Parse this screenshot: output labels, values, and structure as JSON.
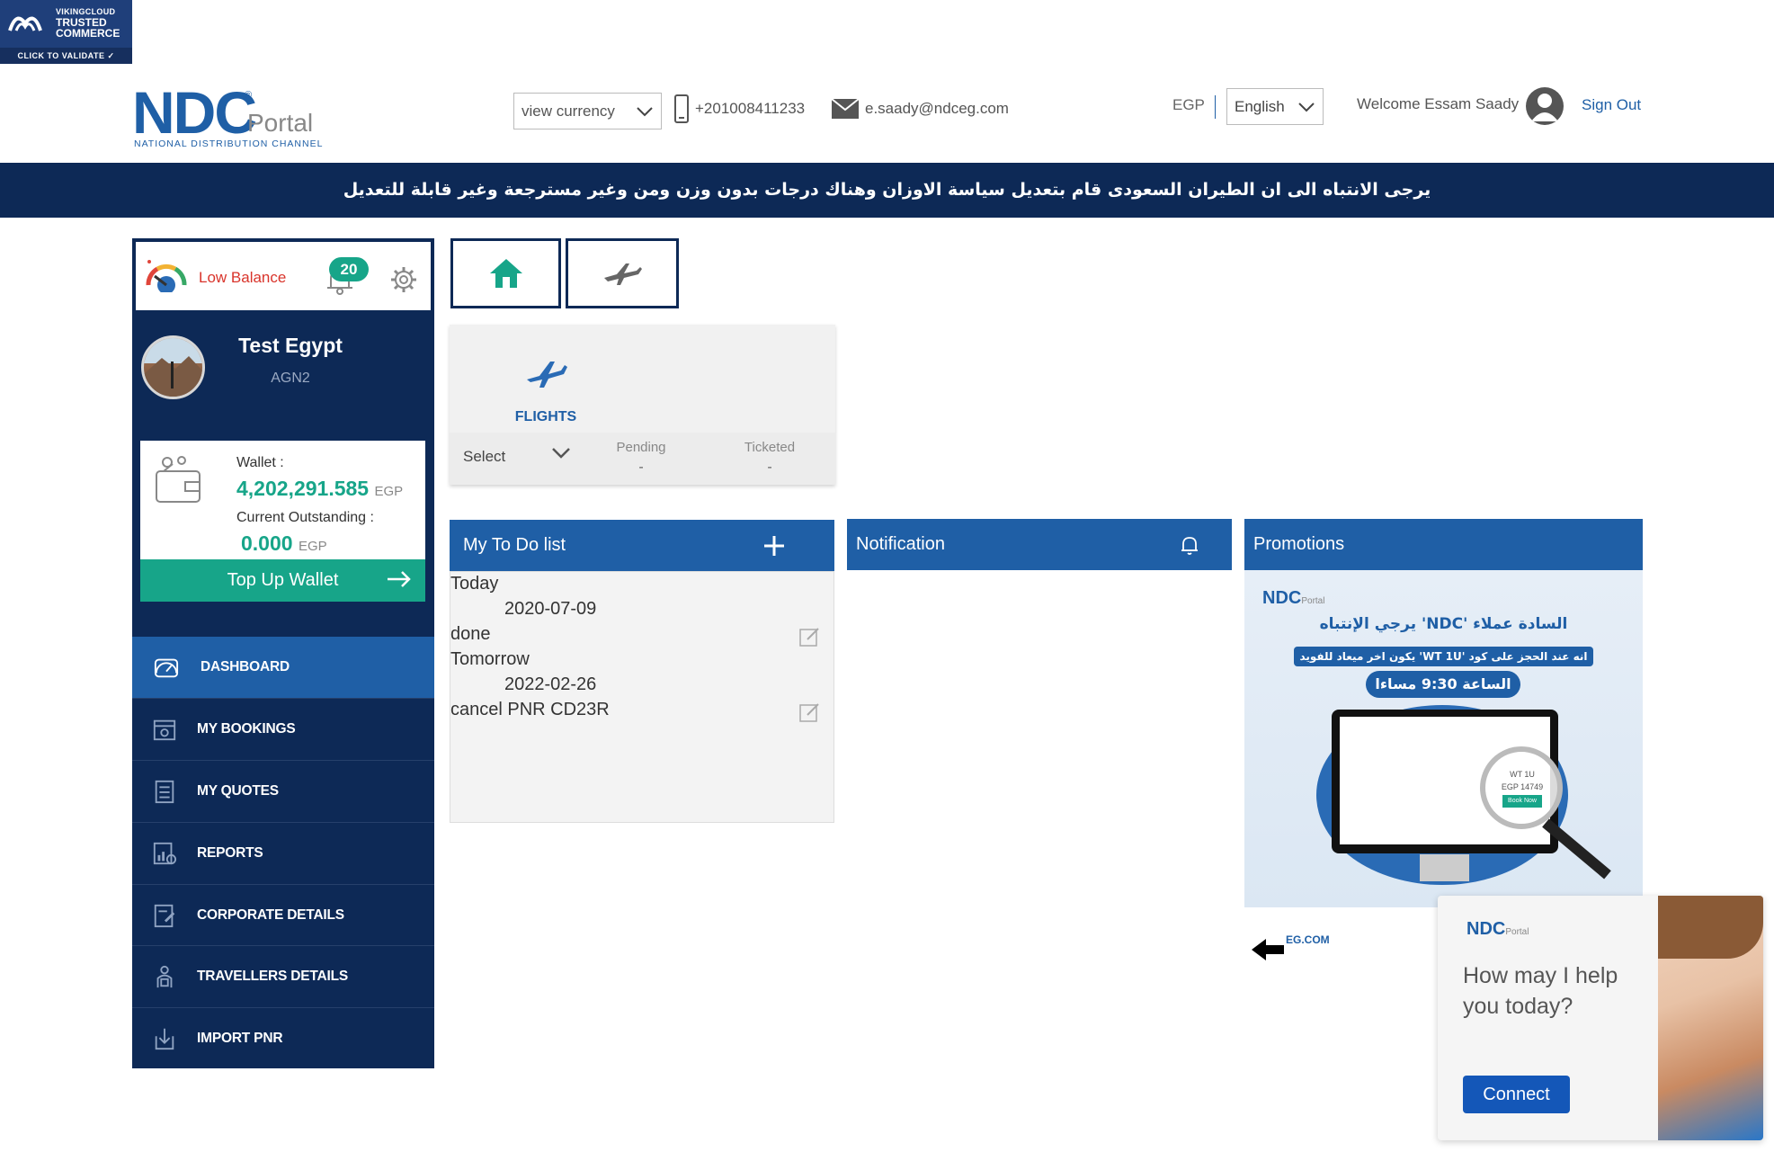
{
  "trust_badge": {
    "line1": "VIKINGCLOUD",
    "line2": "TRUSTED",
    "line3": "COMMERCE",
    "validate": "CLICK TO VALIDATE ✓"
  },
  "logo": {
    "brand": "NDC",
    "reg": "®",
    "portal": "Portal",
    "tagline": "NATIONAL DISTRIBUTION CHANNEL"
  },
  "header": {
    "currency_select": "view currency",
    "phone": "+201008411233",
    "email": "e.saady@ndceg.com",
    "currency": "EGP",
    "language": "English",
    "welcome": "Welcome Essam Saady",
    "sign_out": "Sign Out"
  },
  "announcement": "يرجى الانتباه الى ان الطيران السعودى قام بتعديل سياسة الاوزان وهناك درجات بدون وزن ومن وغير مسترجعة وغير قابلة للتعديل",
  "status": {
    "low_balance": "Low Balance",
    "notification_count": "20"
  },
  "profile": {
    "name": "Test Egypt",
    "code": "AGN2"
  },
  "wallet": {
    "label": "Wallet :",
    "amount": "4,202,291.585",
    "currency": "EGP",
    "outstanding_label": "Current Outstanding :",
    "outstanding_amount": "0.000",
    "outstanding_currency": "EGP",
    "topup_label": "Top Up Wallet"
  },
  "nav": {
    "items": [
      {
        "label": "DASHBOARD",
        "icon": "gauge-icon",
        "active": true
      },
      {
        "label": "MY BOOKINGS",
        "icon": "calendar-icon",
        "active": false
      },
      {
        "label": "MY QUOTES",
        "icon": "checklist-icon",
        "active": false
      },
      {
        "label": "REPORTS",
        "icon": "report-chart-icon",
        "active": false
      },
      {
        "label": "CORPORATE DETAILS",
        "icon": "document-edit-icon",
        "active": false
      },
      {
        "label": "TRAVELLERS DETAILS",
        "icon": "traveller-icon",
        "active": false
      },
      {
        "label": "IMPORT PNR",
        "icon": "import-icon",
        "active": false
      }
    ]
  },
  "flights": {
    "label": "FLIGHTS",
    "select": "Select",
    "pending_label": "Pending",
    "pending_value": "-",
    "ticketed_label": "Ticketed",
    "ticketed_value": "-"
  },
  "todo": {
    "title": "My To Do list",
    "items": [
      {
        "group": "Today",
        "date": "2020-07-09",
        "task": "done"
      },
      {
        "group": "Tomorrow",
        "date": "2022-02-26",
        "task": "cancel PNR CD23R"
      }
    ]
  },
  "notification": {
    "title": "Notification"
  },
  "promotions": {
    "title": "Promotions",
    "logo": "NDC",
    "logo_sub": "Portal",
    "line1": "السادة عملاء 'NDC' يرجي الإنتباه",
    "line2": "انه عند الحجز على كود 'WT 1U' يكون اخر ميعاد للفويد",
    "line3": "الساعة 9:30 مساءا",
    "mag_line1": "WT 1U",
    "mag_line2": "EGP 14749",
    "mag_button": "Book Now",
    "site": "EG.COM"
  },
  "chat": {
    "logo": "NDC",
    "logo_sub": "Portal",
    "message": "How may I help you today?",
    "connect": "Connect"
  },
  "colors": {
    "navy": "#0d2956",
    "blue": "#1f5fa6",
    "teal": "#17a589",
    "red": "#d9342b"
  }
}
